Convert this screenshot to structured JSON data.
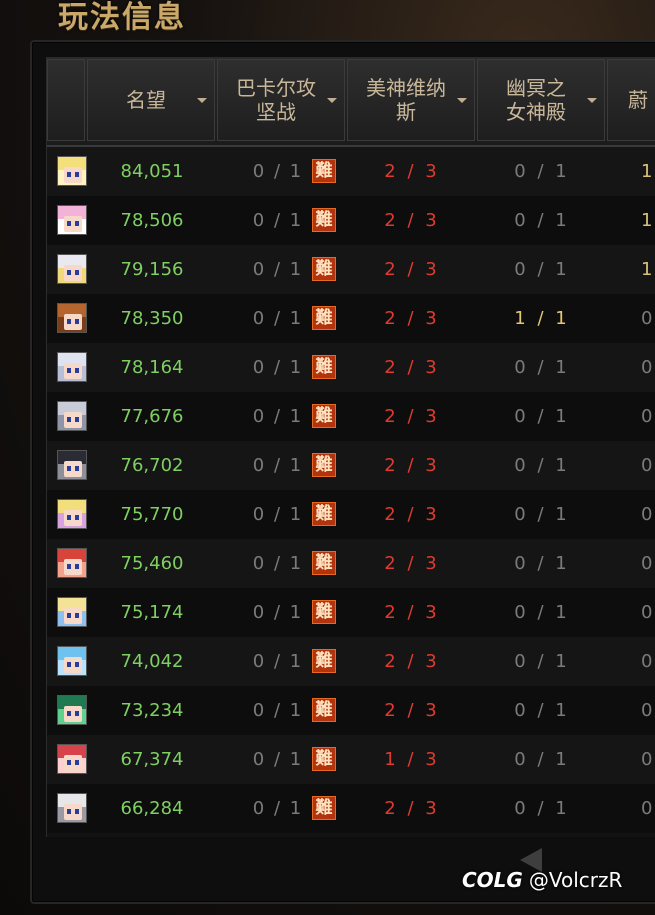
{
  "title": "玩法信息",
  "columns": [
    {
      "label": "名望"
    },
    {
      "label": "巴卡尔攻\n坚战"
    },
    {
      "label": "美神维纳\n斯"
    },
    {
      "label": "幽冥之\n女神殿"
    },
    {
      "label": "蔚"
    }
  ],
  "hard_badge": "難",
  "rows": [
    {
      "avatar": "blonde-character-avatar",
      "fame": "84,051",
      "bakal": "0 / 1",
      "venus": "2 / 3",
      "goddess": "0 / 1",
      "col5": "1"
    },
    {
      "avatar": "pink-hair-character-avatar",
      "fame": "78,506",
      "bakal": "0 / 1",
      "venus": "2 / 3",
      "goddess": "0 / 1",
      "col5": "1"
    },
    {
      "avatar": "white-hair-character-avatar",
      "fame": "79,156",
      "bakal": "0 / 1",
      "venus": "2 / 3",
      "goddess": "0 / 1",
      "col5": "1"
    },
    {
      "avatar": "brown-hair-character-avatar",
      "fame": "78,350",
      "bakal": "0 / 1",
      "venus": "2 / 3",
      "goddess": "1 / 1",
      "col5": "0"
    },
    {
      "avatar": "silver-hair-character-avatar",
      "fame": "78,164",
      "bakal": "0 / 1",
      "venus": "2 / 3",
      "goddess": "0 / 1",
      "col5": "0"
    },
    {
      "avatar": "grey-hair-character-avatar",
      "fame": "77,676",
      "bakal": "0 / 1",
      "venus": "2 / 3",
      "goddess": "0 / 1",
      "col5": "0"
    },
    {
      "avatar": "dark-helmet-character-avatar",
      "fame": "76,702",
      "bakal": "0 / 1",
      "venus": "2 / 3",
      "goddess": "0 / 1",
      "col5": "0"
    },
    {
      "avatar": "blonde-girl-character-avatar",
      "fame": "75,770",
      "bakal": "0 / 1",
      "venus": "2 / 3",
      "goddess": "0 / 1",
      "col5": "0"
    },
    {
      "avatar": "red-mask-character-avatar",
      "fame": "75,460",
      "bakal": "0 / 1",
      "venus": "2 / 3",
      "goddess": "0 / 1",
      "col5": "0"
    },
    {
      "avatar": "blonde-blue-character-avatar",
      "fame": "75,174",
      "bakal": "0 / 1",
      "venus": "2 / 3",
      "goddess": "0 / 1",
      "col5": "0"
    },
    {
      "avatar": "blue-hair-character-avatar",
      "fame": "74,042",
      "bakal": "0 / 1",
      "venus": "2 / 3",
      "goddess": "0 / 1",
      "col5": "0"
    },
    {
      "avatar": "green-creature-character-avatar",
      "fame": "73,234",
      "bakal": "0 / 1",
      "venus": "2 / 3",
      "goddess": "0 / 1",
      "col5": "0"
    },
    {
      "avatar": "red-monster-character-avatar",
      "fame": "67,374",
      "bakal": "0 / 1",
      "venus": "1 / 3",
      "goddess": "0 / 1",
      "col5": "0"
    },
    {
      "avatar": "white-spiky-character-avatar",
      "fame": "66,284",
      "bakal": "0 / 1",
      "venus": "2 / 3",
      "goddess": "0 / 1",
      "col5": "0"
    }
  ],
  "watermark": {
    "logo": "COLG",
    "handle": "@VolcrzR"
  },
  "colors": {
    "fame": "#7fcf63",
    "venus": "#e03a2f",
    "done": "#e5c771",
    "muted": "#7b7b7b"
  }
}
